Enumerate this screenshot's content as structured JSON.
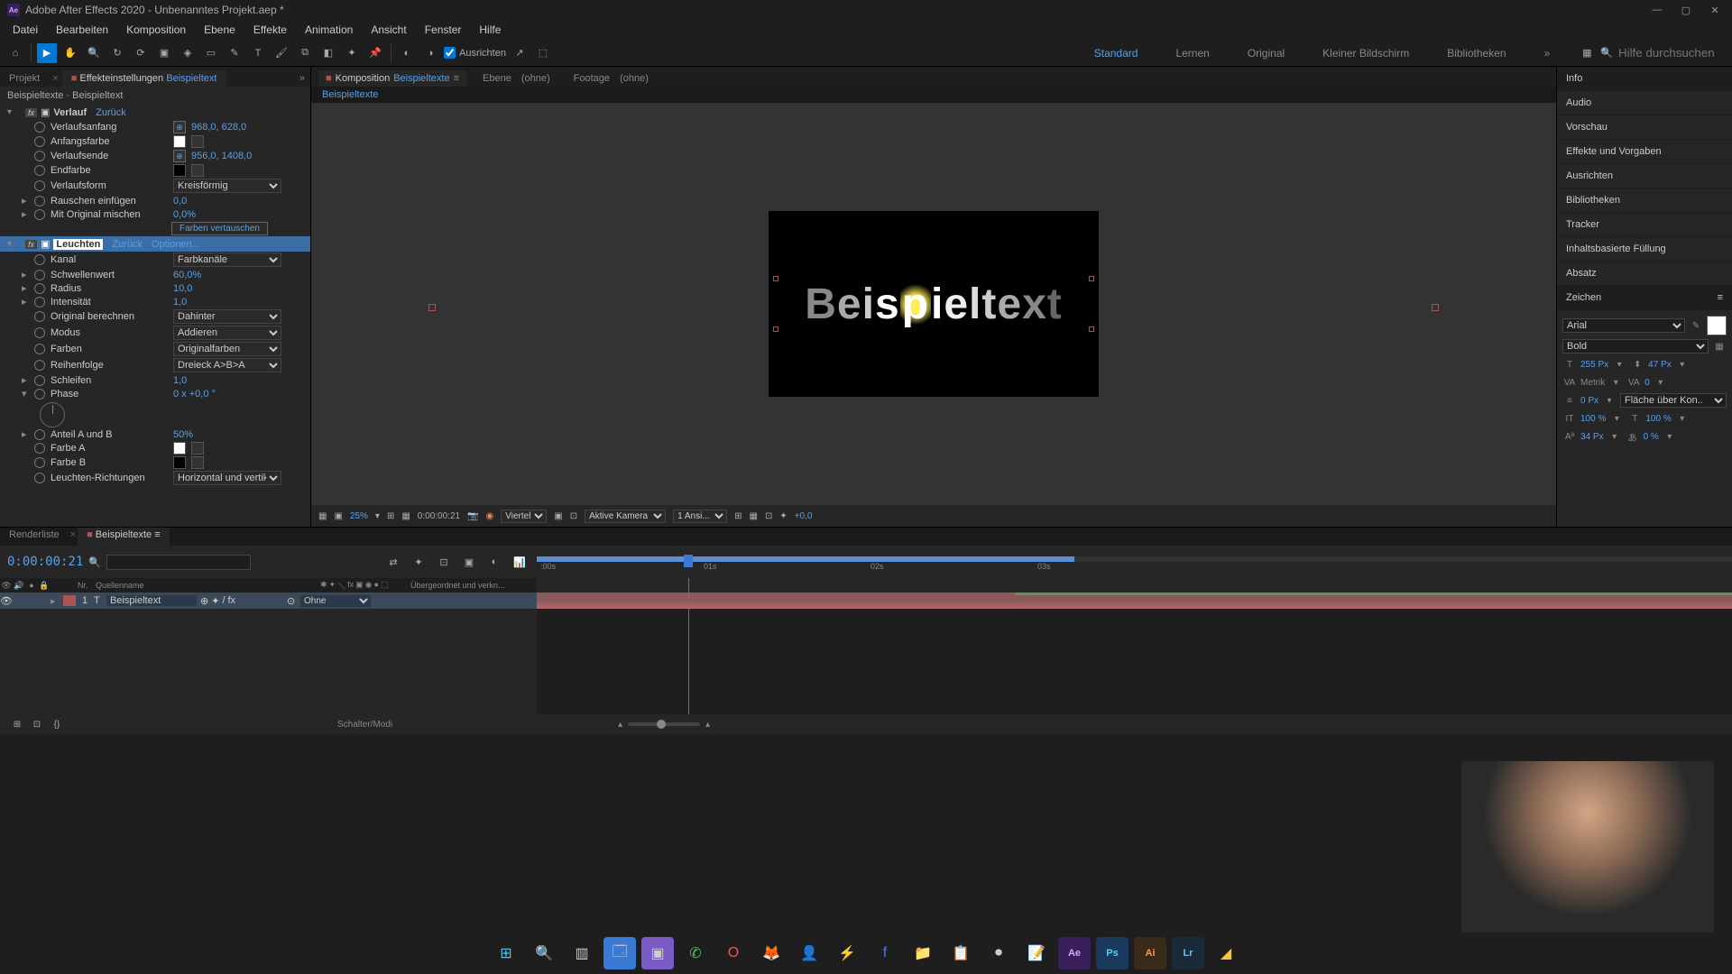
{
  "window": {
    "title": "Adobe After Effects 2020 - Unbenanntes Projekt.aep *",
    "icon_label": "Ae"
  },
  "menu": [
    "Datei",
    "Bearbeiten",
    "Komposition",
    "Ebene",
    "Effekte",
    "Animation",
    "Ansicht",
    "Fenster",
    "Hilfe"
  ],
  "toolbar": {
    "align_label": "Ausrichten",
    "workspaces": [
      "Standard",
      "Lernen",
      "Original",
      "Kleiner Bildschirm",
      "Bibliotheken"
    ],
    "active_workspace": "Standard",
    "search_placeholder": "Hilfe durchsuchen"
  },
  "left_panel": {
    "tab_project": "Projekt",
    "tab_fx": "Effekteinstellungen",
    "tab_fx_target": "Beispieltext",
    "breadcrumb": "Beispieltexte · Beispieltext",
    "fx1": {
      "name": "Verlauf",
      "reset": "Zurück",
      "p_start": "Verlaufsanfang",
      "v_start": "968,0, 628,0",
      "p_startcolor": "Anfangsfarbe",
      "p_end": "Verlaufsende",
      "v_end": "956,0, 1408,0",
      "p_endcolor": "Endfarbe",
      "p_shape": "Verlaufsform",
      "v_shape": "Kreisförmig",
      "p_noise": "Rauschen einfügen",
      "v_noise": "0,0",
      "p_blend": "Mit Original mischen",
      "v_blend": "0,0%",
      "swap": "Farben vertauschen"
    },
    "fx2": {
      "name": "Leuchten",
      "reset": "Zurück",
      "options": "Optionen...",
      "p_channel": "Kanal",
      "v_channel": "Farbkanäle",
      "p_thresh": "Schwellenwert",
      "v_thresh": "60,0%",
      "p_radius": "Radius",
      "v_radius": "10,0",
      "p_intensity": "Intensität",
      "v_intensity": "1,0",
      "p_orig": "Original berechnen",
      "v_orig": "Dahinter",
      "p_mode": "Modus",
      "v_mode": "Addieren",
      "p_colors": "Farben",
      "v_colors": "Originalfarben",
      "p_order": "Reihenfolge",
      "v_order": "Dreieck A>B>A",
      "p_loop": "Schleifen",
      "v_loop": "1,0",
      "p_phase": "Phase",
      "v_phase": "0 x +0,0 °",
      "p_ab": "Anteil A und B",
      "v_ab": "50%",
      "p_ca": "Farbe A",
      "p_cb": "Farbe B",
      "p_dir": "Leuchten-Richtungen",
      "v_dir": "Horizontal und vertikal"
    }
  },
  "viewer": {
    "tab_comp": "Komposition",
    "tab_comp_name": "Beispieltexte",
    "tab_layer": "Ebene",
    "tab_footage": "Footage",
    "none": "(ohne)",
    "breadcrumb": "Beispieltexte",
    "sample_text": "Beispieltext",
    "footer": {
      "zoom": "25%",
      "timecode": "0:00:00:21",
      "quality": "Viertel",
      "camera": "Aktive Kamera",
      "views": "1 Ansi...",
      "exposure": "+0,0"
    }
  },
  "right_panel": {
    "items": [
      "Info",
      "Audio",
      "Vorschau",
      "Effekte und Vorgaben",
      "Ausrichten",
      "Bibliotheken",
      "Tracker",
      "Inhaltsbasierte Füllung",
      "Absatz"
    ],
    "zeichen_title": "Zeichen",
    "font": "Arial",
    "style": "Bold",
    "size": "255 Px",
    "leading": "47 Px",
    "kerning": "Metrik",
    "tracking": "0",
    "stroke": "0 Px",
    "fill_over": "Fläche über Kon..",
    "hscale": "100 %",
    "vscale": "100 %",
    "baseline": "34 Px",
    "tsume": "0 %"
  },
  "timeline": {
    "tab_render": "Renderliste",
    "tab_comp": "Beispieltexte",
    "timecode": "0:00:00:21",
    "col_num": "Nr.",
    "col_source": "Quellenname",
    "col_parent": "Übergeordnet und verkn...",
    "parent_none": "Ohne",
    "layer1": {
      "num": "1",
      "name": "Beispieltext"
    },
    "ruler": {
      "t0": ":00s",
      "t1": "01s",
      "t2": "02s",
      "t3": "03s"
    },
    "footer_mode": "Schalter/Modi"
  }
}
